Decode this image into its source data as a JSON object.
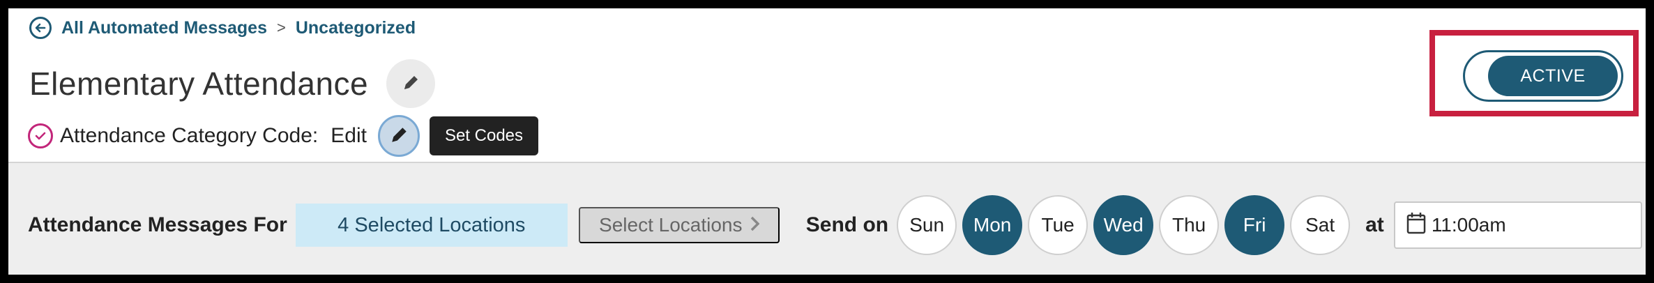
{
  "breadcrumb": {
    "root_label": "All Automated Messages",
    "separator": ">",
    "current_label": "Uncategorized"
  },
  "header": {
    "title": "Elementary Attendance"
  },
  "category": {
    "label": "Attendance Category Code:",
    "edit_label": "Edit",
    "tooltip": "Set Codes"
  },
  "status": {
    "label": "ACTIVE"
  },
  "schedule": {
    "for_label": "Attendance Messages For",
    "selected_locations": "4 Selected Locations",
    "select_locations_button": "Select Locations",
    "send_on_label": "Send on",
    "days": [
      {
        "label": "Sun",
        "selected": false
      },
      {
        "label": "Mon",
        "selected": true
      },
      {
        "label": "Tue",
        "selected": false
      },
      {
        "label": "Wed",
        "selected": true
      },
      {
        "label": "Thu",
        "selected": false
      },
      {
        "label": "Fri",
        "selected": true
      },
      {
        "label": "Sat",
        "selected": false
      }
    ],
    "at_label": "at",
    "time_value": "11:00am"
  },
  "colors": {
    "primary": "#1e5a75",
    "highlight_border": "#c8203f",
    "check_accent": "#c2267a",
    "selection_bg": "#cdeaf7"
  },
  "icons": [
    "back-arrow-icon",
    "pencil-icon",
    "check-circle-icon",
    "chevron-right-icon",
    "calendar-icon"
  ]
}
